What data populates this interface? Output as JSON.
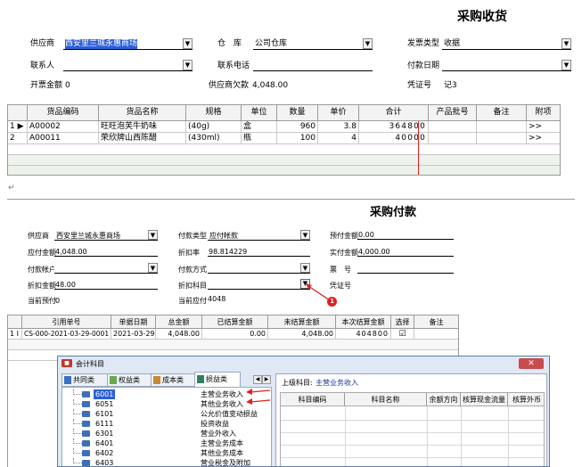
{
  "purchase": {
    "title": "采购收货",
    "supplier_label": "供应商",
    "supplier_value": "西安里兰城永惠商场",
    "warehouse_label": "仓　库",
    "warehouse_value": "公司仓库",
    "invoice_type_label": "发票类型",
    "invoice_type_value": "收据",
    "contact_label": "联系人",
    "contact_phone_label": "联系电话",
    "pay_date_label": "付款日期",
    "invoice_amount_label": "开票金额",
    "invoice_amount_value": "0",
    "supplier_debt_label": "供应商欠款",
    "supplier_debt_value": "4,048.00",
    "voucher_label": "凭证号",
    "voucher_value": "记3",
    "columns": [
      "货品编码",
      "货品名称",
      "规格",
      "单位",
      "数量",
      "单价",
      "合计",
      "产品批号",
      "备注",
      "附项"
    ],
    "rows": [
      {
        "idx": "1",
        "code": "A00002",
        "name": "旺旺泡芙牛奶味",
        "spec": "(40g)",
        "unit": "盒",
        "qty": "960",
        "price": "3.8",
        "total": "364800",
        "extra": ">>"
      },
      {
        "idx": "2",
        "code": "A00011",
        "name": "荣欣牌山西陈醋",
        "spec": "(430ml)",
        "unit": "瓶",
        "qty": "100",
        "price": "4",
        "total": "40000",
        "extra": ">>"
      }
    ]
  },
  "payment": {
    "title": "采购付款",
    "supplier_label": "供应商",
    "supplier_value": "西安里兰城永惠商场",
    "pay_type_label": "付款类型",
    "pay_type_value": "应付帐款",
    "prepaid_label": "预付金额",
    "prepaid_value": "0.00",
    "payable_label": "应付金额",
    "payable_value": "4,048.00",
    "discount_rate_label": "折扣率",
    "discount_rate_value": "98.814229",
    "actual_pay_label": "实付金额",
    "actual_pay_value": "4,000.00",
    "account_label": "付款帐户",
    "method_label": "付款方式",
    "ticket_label": "票　号",
    "discount_amount_label": "折扣金额",
    "discount_amount_value": "48.00",
    "discount_subject_label": "折扣科目",
    "voucher_label": "凭证号",
    "current_prepaid_label": "当前预付",
    "current_prepaid_value": "0",
    "current_payable_label": "当前应付",
    "current_payable_value": "4048",
    "badge": "1",
    "columns": [
      "引用单号",
      "单据日期",
      "总金额",
      "已结算金额",
      "未结算金额",
      "本次结算金额",
      "选择",
      "备注"
    ],
    "rows": [
      {
        "idx": "1",
        "ref": "CS-000-2021-03-29-0001",
        "date": "2021-03-29",
        "total": "4,048.00",
        "settled": "0.00",
        "unsettled": "4,048.00",
        "current": "404800",
        "checked": "☑"
      }
    ]
  },
  "dialog": {
    "title": "会计科目",
    "tabs": [
      "共同类",
      "权益类",
      "成本类",
      "损益类"
    ],
    "parent_label": "上级科目:",
    "parent_value": "主营业务收入",
    "tree": [
      {
        "code": "6001",
        "name": "主营业务收入"
      },
      {
        "code": "6051",
        "name": "其他业务收入"
      },
      {
        "code": "6101",
        "name": "公允价值变动损益"
      },
      {
        "code": "6111",
        "name": "投资收益"
      },
      {
        "code": "6301",
        "name": "营业外收入"
      },
      {
        "code": "6401",
        "name": "主营业务成本"
      },
      {
        "code": "6402",
        "name": "其他业务成本"
      },
      {
        "code": "6403",
        "name": "营业税金及附加"
      }
    ],
    "columns": [
      "科目编码",
      "科目名称",
      "余额方向",
      "核算现金流量",
      "核算外币"
    ]
  },
  "colors": {
    "accent": "#2b5fd9",
    "red": "#e02020"
  }
}
